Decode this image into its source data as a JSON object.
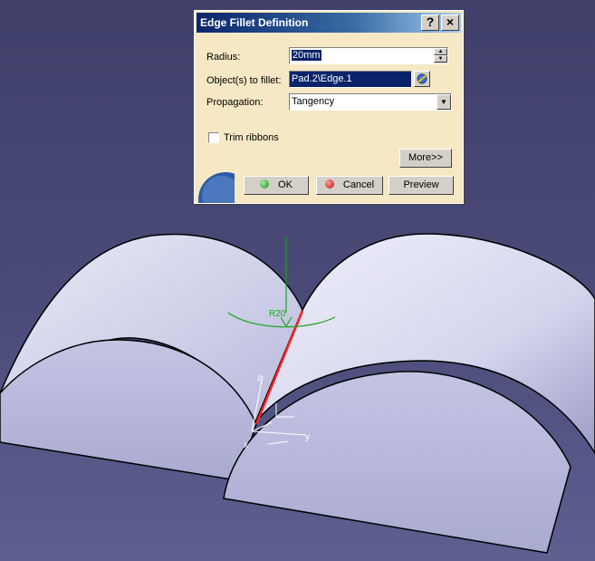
{
  "dialog": {
    "title": "Edge Fillet Definition",
    "help_label": "?",
    "close_label": "×",
    "radius_label": "Radius:",
    "radius_value": "20mm",
    "objects_label": "Object(s) to fillet:",
    "objects_value": "Pad.2\\Edge.1",
    "propagation_label": "Propagation:",
    "propagation_value": "Tangency",
    "trim_label": "Trim ribbons",
    "trim_checked": false,
    "more_label": "More>>",
    "ok_label": "OK",
    "cancel_label": "Cancel",
    "preview_label": "Preview"
  },
  "viewport": {
    "radius_annotation": "R20",
    "axis_x": "x",
    "axis_y": "y",
    "axis_z": "z"
  },
  "colors": {
    "background": "#45466f",
    "solid_face": "#c9cae8",
    "selected_edge": "#ff2020",
    "annotation": "#1aa51a"
  }
}
